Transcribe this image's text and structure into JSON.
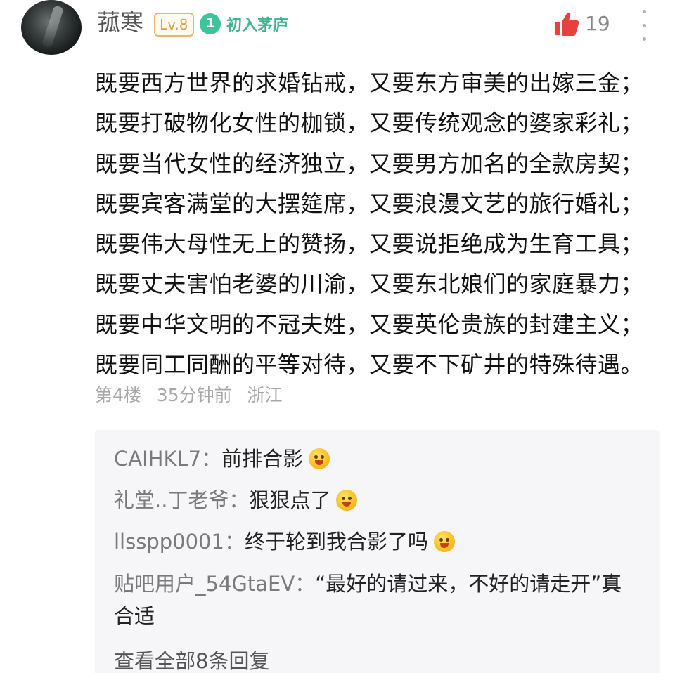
{
  "post": {
    "author": "菰寒",
    "level": "Lv.8",
    "rank_number": "1",
    "rank_title": "初入茅庐",
    "likes": "19",
    "lines": [
      "既要西方世界的求婚钻戒，又要东方审美的出嫁三金；",
      "既要打破物化女性的枷锁，又要传统观念的婆家彩礼；",
      "既要当代女性的经济独立，又要男方加名的全款房契；",
      "既要宾客满堂的大摆筵席，又要浪漫文艺的旅行婚礼；",
      "既要伟大母性无上的赞扬，又要说拒绝成为生育工具；",
      "既要丈夫害怕老婆的川渝，又要东北娘们的家庭暴力；",
      "既要中华文明的不冠夫姓，又要英伦贵族的封建主义；",
      "既要同工同酬的平等对待，又要不下矿井的特殊待遇。"
    ],
    "floor": "第4楼",
    "time": "35分钟前",
    "location": "浙江"
  },
  "replies": [
    {
      "name": "CAIHKL7：",
      "text": "前排合影",
      "emoji": "laughing-emoji"
    },
    {
      "name": "礼堂..丁老爷：",
      "text": "狠狠点了",
      "emoji": "grimace-emoji"
    },
    {
      "name": "llsspp0001：",
      "text": "终于轮到我合影了吗",
      "emoji": "grin-emoji"
    },
    {
      "name": "贴吧用户_54GtaEV：",
      "text": "“最好的请过来，不好的请走开”真合适",
      "emoji": ""
    }
  ],
  "view_all": "查看全部8条回复",
  "colors": {
    "like_red": "#e8413b",
    "rank_green": "#3fc39a",
    "level_gold": "#d9a04a",
    "reply_bg": "#f6f6f8"
  },
  "icons": {
    "like": "thumbs-up-icon",
    "more": "more-vertical-icon",
    "rank": "gem-icon"
  }
}
